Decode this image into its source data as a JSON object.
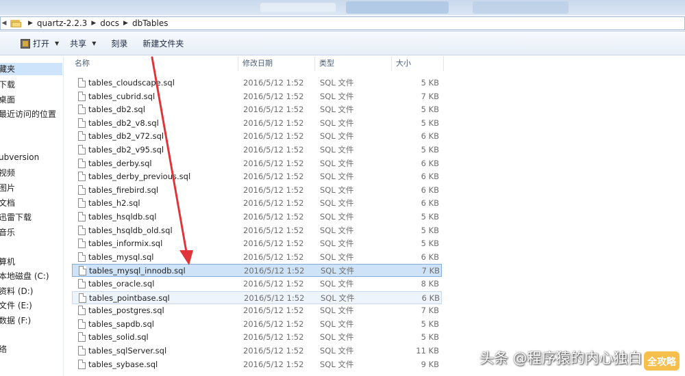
{
  "address": {
    "crumbs": [
      "quartz-2.2.3",
      "docs",
      "dbTables"
    ]
  },
  "toolbar": {
    "open_label": "打开",
    "share_label": "共享",
    "burn_label": "刻录",
    "new_folder_label": "新建文件夹"
  },
  "nav": {
    "items": [
      "藏夹",
      "下载",
      "桌面",
      "最近访问的位置",
      "ubversion",
      "视频",
      "图片",
      "文档",
      "迅雷下载",
      "音乐",
      "算机",
      "本地磁盘 (C:)",
      "资料 (D:)",
      "文件 (E:)",
      "数据 (F:)",
      "络"
    ]
  },
  "list": {
    "columns": [
      "名称",
      "修改日期",
      "类型",
      "大小"
    ],
    "rows": [
      {
        "name": "tables_cloudscape.sql",
        "date": "2016/5/12 1:52",
        "type": "SQL 文件",
        "size": "5 KB"
      },
      {
        "name": "tables_cubrid.sql",
        "date": "2016/5/12 1:52",
        "type": "SQL 文件",
        "size": "7 KB"
      },
      {
        "name": "tables_db2.sql",
        "date": "2016/5/12 1:52",
        "type": "SQL 文件",
        "size": "5 KB"
      },
      {
        "name": "tables_db2_v8.sql",
        "date": "2016/5/12 1:52",
        "type": "SQL 文件",
        "size": "5 KB"
      },
      {
        "name": "tables_db2_v72.sql",
        "date": "2016/5/12 1:52",
        "type": "SQL 文件",
        "size": "6 KB"
      },
      {
        "name": "tables_db2_v95.sql",
        "date": "2016/5/12 1:52",
        "type": "SQL 文件",
        "size": "5 KB"
      },
      {
        "name": "tables_derby.sql",
        "date": "2016/5/12 1:52",
        "type": "SQL 文件",
        "size": "6 KB"
      },
      {
        "name": "tables_derby_previous.sql",
        "date": "2016/5/12 1:52",
        "type": "SQL 文件",
        "size": "6 KB"
      },
      {
        "name": "tables_firebird.sql",
        "date": "2016/5/12 1:52",
        "type": "SQL 文件",
        "size": "6 KB"
      },
      {
        "name": "tables_h2.sql",
        "date": "2016/5/12 1:52",
        "type": "SQL 文件",
        "size": "6 KB"
      },
      {
        "name": "tables_hsqldb.sql",
        "date": "2016/5/12 1:52",
        "type": "SQL 文件",
        "size": "5 KB"
      },
      {
        "name": "tables_hsqldb_old.sql",
        "date": "2016/5/12 1:52",
        "type": "SQL 文件",
        "size": "5 KB"
      },
      {
        "name": "tables_informix.sql",
        "date": "2016/5/12 1:52",
        "type": "SQL 文件",
        "size": "5 KB"
      },
      {
        "name": "tables_mysql.sql",
        "date": "2016/5/12 1:52",
        "type": "SQL 文件",
        "size": "6 KB"
      },
      {
        "name": "tables_mysql_innodb.sql",
        "date": "2016/5/12 1:52",
        "type": "SQL 文件",
        "size": "7 KB"
      },
      {
        "name": "tables_oracle.sql",
        "date": "2016/5/12 1:52",
        "type": "SQL 文件",
        "size": "8 KB"
      },
      {
        "name": "tables_pointbase.sql",
        "date": "2016/5/12 1:52",
        "type": "SQL 文件",
        "size": "6 KB"
      },
      {
        "name": "tables_postgres.sql",
        "date": "2016/5/12 1:52",
        "type": "SQL 文件",
        "size": "7 KB"
      },
      {
        "name": "tables_sapdb.sql",
        "date": "2016/5/12 1:52",
        "type": "SQL 文件",
        "size": "5 KB"
      },
      {
        "name": "tables_solid.sql",
        "date": "2016/5/12 1:52",
        "type": "SQL 文件",
        "size": "5 KB"
      },
      {
        "name": "tables_sqlServer.sql",
        "date": "2016/5/12 1:52",
        "type": "SQL 文件",
        "size": "11 KB"
      },
      {
        "name": "tables_sybase.sql",
        "date": "2016/5/12 1:52",
        "type": "SQL 文件",
        "size": "9 KB"
      }
    ]
  },
  "annotation": {
    "arrow_color": "#e0343a"
  },
  "watermark": {
    "text": "头条 @程序猿的内心独白",
    "logo_text": "全攻略"
  }
}
